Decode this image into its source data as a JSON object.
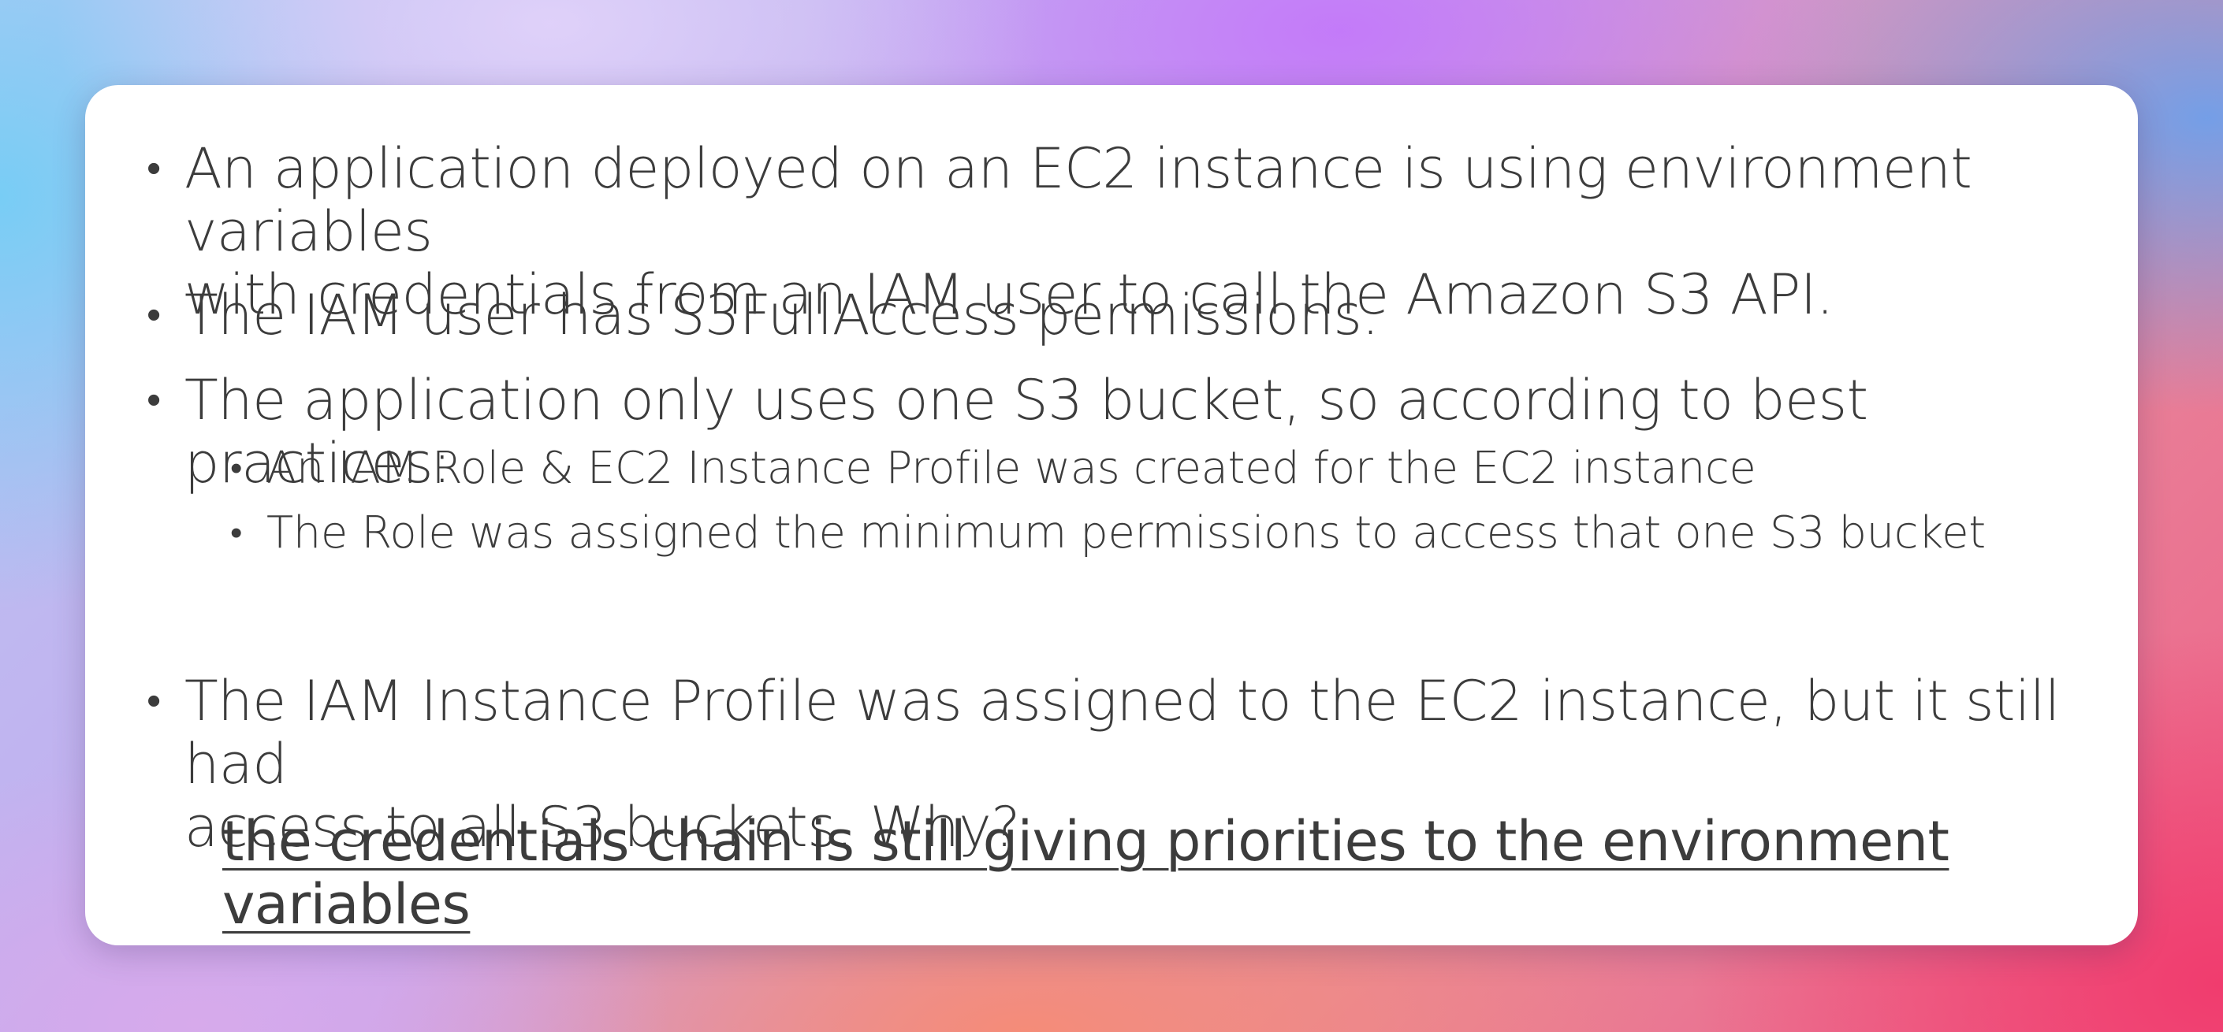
{
  "slide": {
    "bullets": [
      {
        "line1": "An application deployed on an EC2 instance is using environment variables",
        "line2": "with credentials from an IAM user to call the Amazon S3 API."
      },
      {
        "line1": "The IAM user has S3FullAccess permissions."
      },
      {
        "line1": "The application only uses one S3 bucket, so according to best practices:",
        "sub": [
          "An IAM Role & EC2 Instance Profile was created for the EC2 instance",
          "The Role was assigned the minimum permissions to access that one S3 bucket"
        ]
      },
      {
        "line1": "The IAM Instance Profile was assigned to the EC2 instance, but it still had",
        "line2": "access to all S3 buckets. Why?"
      }
    ],
    "answer": "the credentials chain is still giving priorities to the environment variables",
    "bullet_glyph": "•"
  }
}
